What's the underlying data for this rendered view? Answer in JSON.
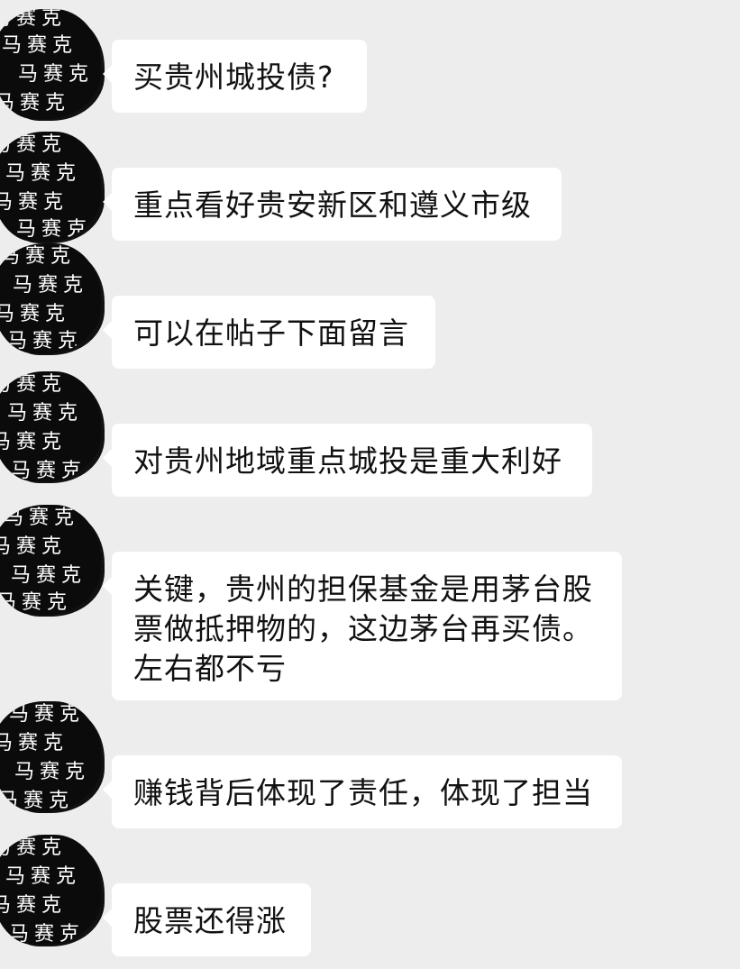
{
  "chat": {
    "watermark_text": "马赛克",
    "messages": [
      {
        "text": "买贵州城投债?"
      },
      {
        "text": "重点看好贵安新区和遵义市级"
      },
      {
        "text": "可以在帖子下面留言"
      },
      {
        "text": "对贵州地域重点城投是重大利好"
      },
      {
        "text": "关键，贵州的担保基金是用茅台股票做抵押物的，这边茅台再买债。左右都不亏"
      },
      {
        "text": "赚钱背后体现了责任，体现了担当"
      },
      {
        "text": "股票还得涨"
      }
    ]
  }
}
